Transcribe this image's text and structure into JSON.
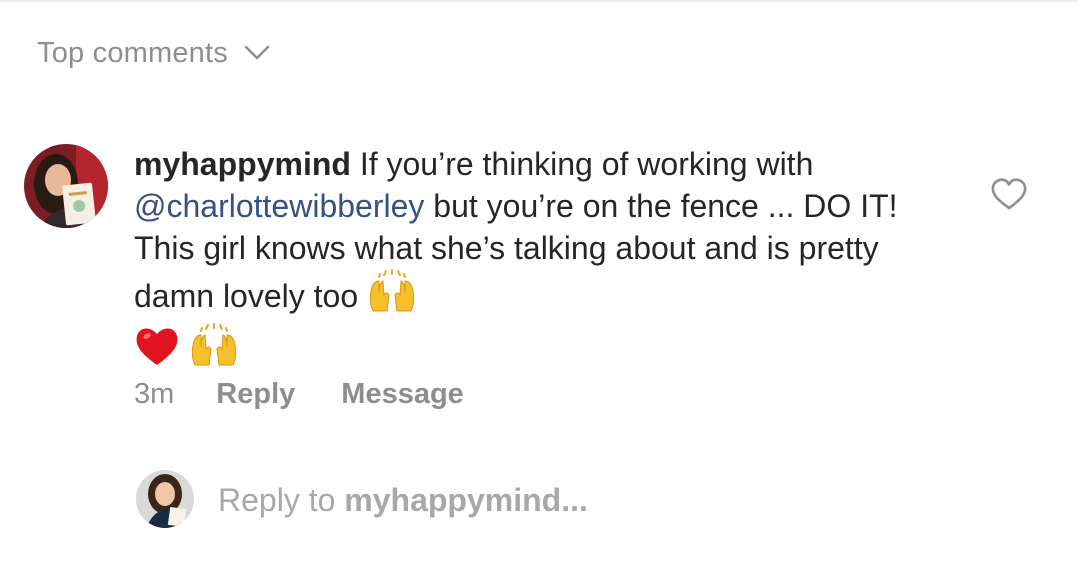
{
  "header": {
    "sort_label": "Top comments",
    "chevron_icon": "chevron-down-icon"
  },
  "comment": {
    "username": "myhappymind",
    "text_part1": "If you’re thinking of working with",
    "mention": "@charlottewibberley",
    "text_part2": "but you’re on the fence ... DO IT! This girl knows what she’s talking about and is pretty damn lovely too",
    "emojis": [
      "raising-hands-emoji",
      "red-heart-emoji",
      "raising-hands-emoji"
    ],
    "like_icon": "heart-outline-icon",
    "timestamp": "3m",
    "reply_label": "Reply",
    "message_label": "Message"
  },
  "reply_box": {
    "placeholder_prefix": "Reply to",
    "placeholder_user": "myhappymind..."
  },
  "colors": {
    "mention": "#385185",
    "muted": "#8e8e8e",
    "text": "#262626",
    "placeholder": "#a8a8a8"
  }
}
